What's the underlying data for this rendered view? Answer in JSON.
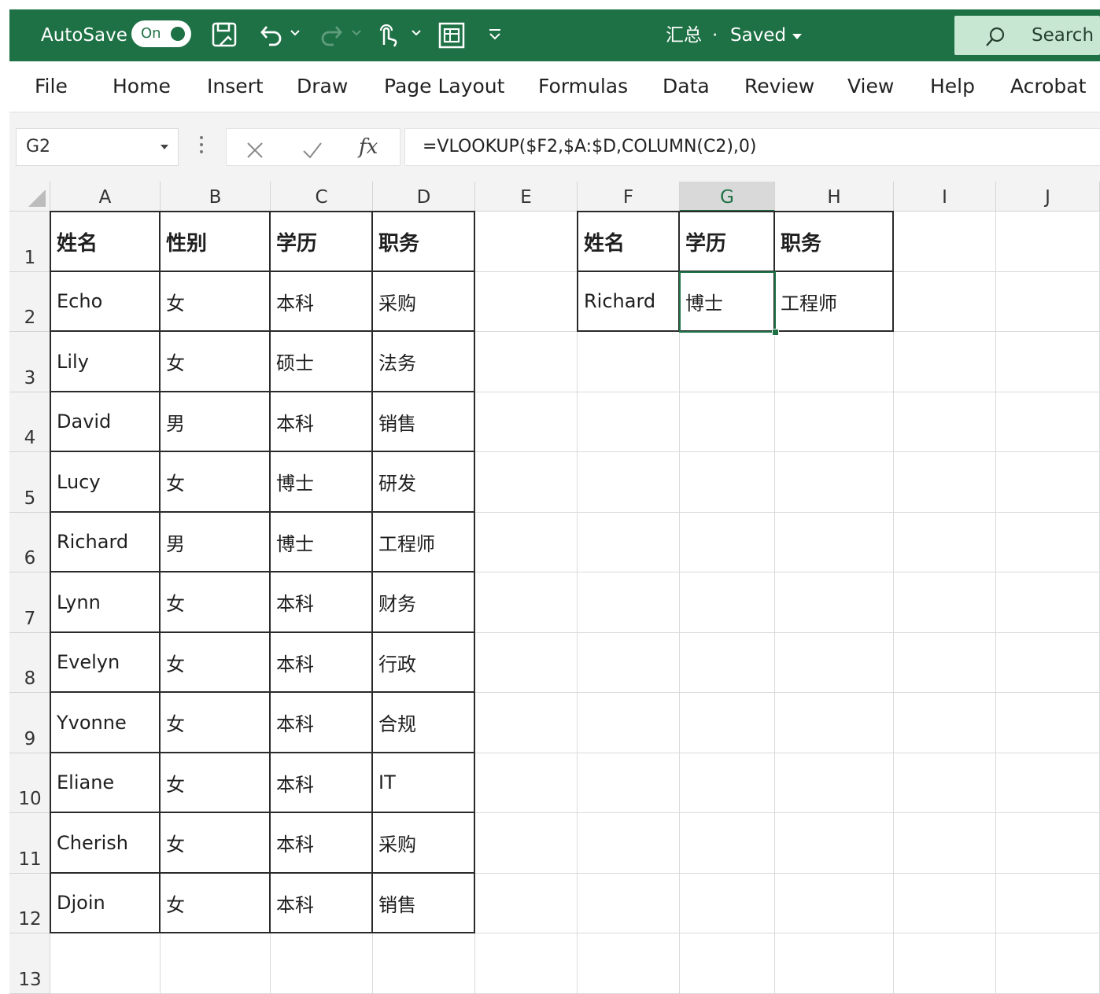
{
  "titlebar": {
    "autosave_label": "AutoSave",
    "autosave_state": "On",
    "doc_title": "汇总",
    "separator": "·",
    "save_status": "Saved",
    "search_label": "Search",
    "colors": {
      "bar": "#1e7145",
      "search_bg": "#c7e7d3"
    },
    "icons": [
      "save-icon",
      "undo-icon",
      "redo-icon",
      "touch-mode-icon",
      "form-icon",
      "customize-toolbar-icon",
      "search-icon"
    ]
  },
  "menu": [
    "File",
    "Home",
    "Insert",
    "Draw",
    "Page Layout",
    "Formulas",
    "Data",
    "Review",
    "View",
    "Help",
    "Acrobat"
  ],
  "formula_bar": {
    "name_box": "G2",
    "fx_label": "fx",
    "formula": "=VLOOKUP($F2,$A:$D,COLUMN(C2),0)"
  },
  "sheet": {
    "columns": [
      "A",
      "B",
      "C",
      "D",
      "E",
      "F",
      "G",
      "H",
      "I",
      "J"
    ],
    "rows": [
      "1",
      "2",
      "3",
      "4",
      "5",
      "6",
      "7",
      "8",
      "9",
      "10",
      "11",
      "12",
      "13"
    ],
    "selected_cell": "G2",
    "source_table": {
      "headers": [
        "姓名",
        "性别",
        "学历",
        "职务"
      ],
      "rows": [
        [
          "Echo",
          "女",
          "本科",
          "采购"
        ],
        [
          "Lily",
          "女",
          "硕士",
          "法务"
        ],
        [
          "David",
          "男",
          "本科",
          "销售"
        ],
        [
          "Lucy",
          "女",
          "博士",
          "研发"
        ],
        [
          "Richard",
          "男",
          "博士",
          "工程师"
        ],
        [
          "Lynn",
          "女",
          "本科",
          "财务"
        ],
        [
          "Evelyn",
          "女",
          "本科",
          "行政"
        ],
        [
          "Yvonne",
          "女",
          "本科",
          "合规"
        ],
        [
          "Eliane",
          "女",
          "本科",
          "IT"
        ],
        [
          "Cherish",
          "女",
          "本科",
          "采购"
        ],
        [
          "Djoin",
          "女",
          "本科",
          "销售"
        ]
      ]
    },
    "lookup_table": {
      "headers": [
        "姓名",
        "学历",
        "职务"
      ],
      "rows": [
        [
          "Richard",
          "博士",
          "工程师"
        ]
      ]
    }
  }
}
